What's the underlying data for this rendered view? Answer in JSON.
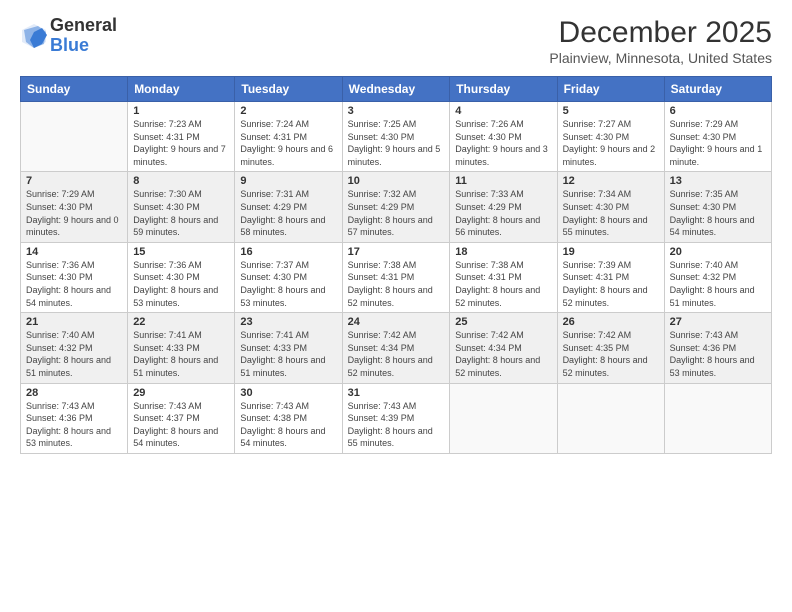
{
  "header": {
    "logo_general": "General",
    "logo_blue": "Blue",
    "month_title": "December 2025",
    "location": "Plainview, Minnesota, United States"
  },
  "days_of_week": [
    "Sunday",
    "Monday",
    "Tuesday",
    "Wednesday",
    "Thursday",
    "Friday",
    "Saturday"
  ],
  "weeks": [
    [
      {
        "day": "",
        "empty": true
      },
      {
        "day": "1",
        "sunrise": "Sunrise: 7:23 AM",
        "sunset": "Sunset: 4:31 PM",
        "daylight": "Daylight: 9 hours and 7 minutes."
      },
      {
        "day": "2",
        "sunrise": "Sunrise: 7:24 AM",
        "sunset": "Sunset: 4:31 PM",
        "daylight": "Daylight: 9 hours and 6 minutes."
      },
      {
        "day": "3",
        "sunrise": "Sunrise: 7:25 AM",
        "sunset": "Sunset: 4:30 PM",
        "daylight": "Daylight: 9 hours and 5 minutes."
      },
      {
        "day": "4",
        "sunrise": "Sunrise: 7:26 AM",
        "sunset": "Sunset: 4:30 PM",
        "daylight": "Daylight: 9 hours and 3 minutes."
      },
      {
        "day": "5",
        "sunrise": "Sunrise: 7:27 AM",
        "sunset": "Sunset: 4:30 PM",
        "daylight": "Daylight: 9 hours and 2 minutes."
      },
      {
        "day": "6",
        "sunrise": "Sunrise: 7:29 AM",
        "sunset": "Sunset: 4:30 PM",
        "daylight": "Daylight: 9 hours and 1 minute."
      }
    ],
    [
      {
        "day": "7",
        "sunrise": "Sunrise: 7:29 AM",
        "sunset": "Sunset: 4:30 PM",
        "daylight": "Daylight: 9 hours and 0 minutes."
      },
      {
        "day": "8",
        "sunrise": "Sunrise: 7:30 AM",
        "sunset": "Sunset: 4:30 PM",
        "daylight": "Daylight: 8 hours and 59 minutes."
      },
      {
        "day": "9",
        "sunrise": "Sunrise: 7:31 AM",
        "sunset": "Sunset: 4:29 PM",
        "daylight": "Daylight: 8 hours and 58 minutes."
      },
      {
        "day": "10",
        "sunrise": "Sunrise: 7:32 AM",
        "sunset": "Sunset: 4:29 PM",
        "daylight": "Daylight: 8 hours and 57 minutes."
      },
      {
        "day": "11",
        "sunrise": "Sunrise: 7:33 AM",
        "sunset": "Sunset: 4:29 PM",
        "daylight": "Daylight: 8 hours and 56 minutes."
      },
      {
        "day": "12",
        "sunrise": "Sunrise: 7:34 AM",
        "sunset": "Sunset: 4:30 PM",
        "daylight": "Daylight: 8 hours and 55 minutes."
      },
      {
        "day": "13",
        "sunrise": "Sunrise: 7:35 AM",
        "sunset": "Sunset: 4:30 PM",
        "daylight": "Daylight: 8 hours and 54 minutes."
      }
    ],
    [
      {
        "day": "14",
        "sunrise": "Sunrise: 7:36 AM",
        "sunset": "Sunset: 4:30 PM",
        "daylight": "Daylight: 8 hours and 54 minutes."
      },
      {
        "day": "15",
        "sunrise": "Sunrise: 7:36 AM",
        "sunset": "Sunset: 4:30 PM",
        "daylight": "Daylight: 8 hours and 53 minutes."
      },
      {
        "day": "16",
        "sunrise": "Sunrise: 7:37 AM",
        "sunset": "Sunset: 4:30 PM",
        "daylight": "Daylight: 8 hours and 53 minutes."
      },
      {
        "day": "17",
        "sunrise": "Sunrise: 7:38 AM",
        "sunset": "Sunset: 4:31 PM",
        "daylight": "Daylight: 8 hours and 52 minutes."
      },
      {
        "day": "18",
        "sunrise": "Sunrise: 7:38 AM",
        "sunset": "Sunset: 4:31 PM",
        "daylight": "Daylight: 8 hours and 52 minutes."
      },
      {
        "day": "19",
        "sunrise": "Sunrise: 7:39 AM",
        "sunset": "Sunset: 4:31 PM",
        "daylight": "Daylight: 8 hours and 52 minutes."
      },
      {
        "day": "20",
        "sunrise": "Sunrise: 7:40 AM",
        "sunset": "Sunset: 4:32 PM",
        "daylight": "Daylight: 8 hours and 51 minutes."
      }
    ],
    [
      {
        "day": "21",
        "sunrise": "Sunrise: 7:40 AM",
        "sunset": "Sunset: 4:32 PM",
        "daylight": "Daylight: 8 hours and 51 minutes."
      },
      {
        "day": "22",
        "sunrise": "Sunrise: 7:41 AM",
        "sunset": "Sunset: 4:33 PM",
        "daylight": "Daylight: 8 hours and 51 minutes."
      },
      {
        "day": "23",
        "sunrise": "Sunrise: 7:41 AM",
        "sunset": "Sunset: 4:33 PM",
        "daylight": "Daylight: 8 hours and 51 minutes."
      },
      {
        "day": "24",
        "sunrise": "Sunrise: 7:42 AM",
        "sunset": "Sunset: 4:34 PM",
        "daylight": "Daylight: 8 hours and 52 minutes."
      },
      {
        "day": "25",
        "sunrise": "Sunrise: 7:42 AM",
        "sunset": "Sunset: 4:34 PM",
        "daylight": "Daylight: 8 hours and 52 minutes."
      },
      {
        "day": "26",
        "sunrise": "Sunrise: 7:42 AM",
        "sunset": "Sunset: 4:35 PM",
        "daylight": "Daylight: 8 hours and 52 minutes."
      },
      {
        "day": "27",
        "sunrise": "Sunrise: 7:43 AM",
        "sunset": "Sunset: 4:36 PM",
        "daylight": "Daylight: 8 hours and 53 minutes."
      }
    ],
    [
      {
        "day": "28",
        "sunrise": "Sunrise: 7:43 AM",
        "sunset": "Sunset: 4:36 PM",
        "daylight": "Daylight: 8 hours and 53 minutes."
      },
      {
        "day": "29",
        "sunrise": "Sunrise: 7:43 AM",
        "sunset": "Sunset: 4:37 PM",
        "daylight": "Daylight: 8 hours and 54 minutes."
      },
      {
        "day": "30",
        "sunrise": "Sunrise: 7:43 AM",
        "sunset": "Sunset: 4:38 PM",
        "daylight": "Daylight: 8 hours and 54 minutes."
      },
      {
        "day": "31",
        "sunrise": "Sunrise: 7:43 AM",
        "sunset": "Sunset: 4:39 PM",
        "daylight": "Daylight: 8 hours and 55 minutes."
      },
      {
        "day": "",
        "empty": true
      },
      {
        "day": "",
        "empty": true
      },
      {
        "day": "",
        "empty": true
      }
    ]
  ]
}
